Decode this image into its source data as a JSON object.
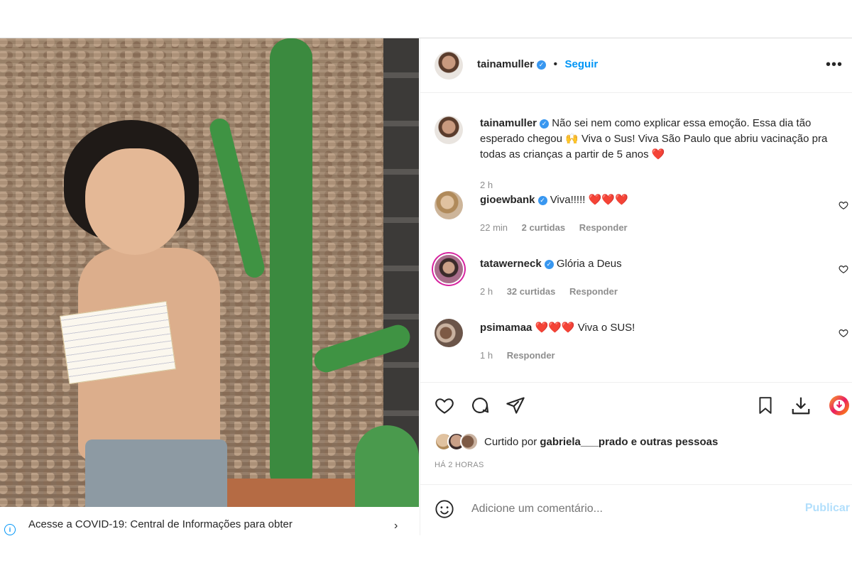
{
  "header": {
    "username": "tainamuller",
    "follow_label": "Seguir",
    "more_icon": "more-horizontal-icon"
  },
  "caption": {
    "username": "tainamuller",
    "text": "Não sei nem como explicar essa emoção. Essa dia tão esperado chegou 🙌 Viva o Sus! Viva São Paulo que abriu vacinação pra todas as crianças a partir de 5 anos ❤️",
    "time": "2 h"
  },
  "comments": [
    {
      "username": "gioewbank",
      "verified": true,
      "text": "Viva!!!!! ❤️❤️❤️",
      "time": "22 min",
      "likes": "2 curtidas",
      "reply": "Responder"
    },
    {
      "username": "tatawerneck",
      "verified": true,
      "text": "Glória a Deus",
      "time": "2 h",
      "likes": "32 curtidas",
      "reply": "Responder"
    },
    {
      "username": "psimamaa",
      "verified": false,
      "text": "❤️❤️❤️ Viva o SUS!",
      "time": "1 h",
      "likes": "",
      "reply": "Responder"
    }
  ],
  "likes": {
    "prefix": "Curtido por",
    "user": "gabriela___prado",
    "suffix": "e outras pessoas"
  },
  "timestamp": "HÁ 2 HORAS",
  "add_comment": {
    "placeholder": "Adicione um comentário...",
    "publish_label": "Publicar"
  },
  "covid_banner": {
    "text": "Acesse a COVID-19: Central de Informações para obter"
  },
  "colors": {
    "link_blue": "#0095f6",
    "verified_blue": "#3897f0",
    "heart_red": "#ed4956",
    "publish_disabled": "#b2dffc",
    "muted_gray": "#8e8e8e"
  }
}
